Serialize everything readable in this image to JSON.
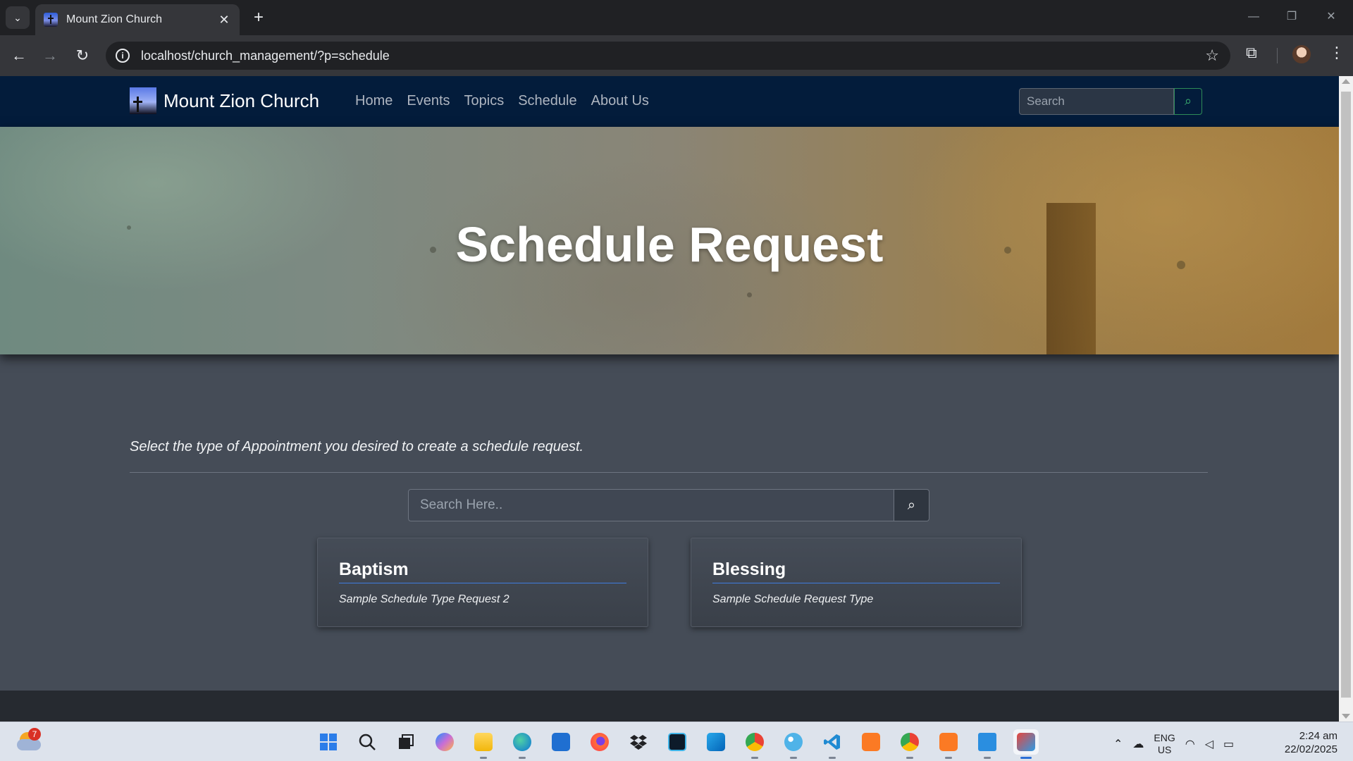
{
  "browser": {
    "tab_title": "Mount Zion Church",
    "url": "localhost/church_management/?p=schedule"
  },
  "site": {
    "brand_name": "Mount Zion Church",
    "nav_links": [
      "Home",
      "Events",
      "Topics",
      "Schedule",
      "About Us"
    ],
    "search_placeholder": "Search"
  },
  "hero": {
    "title": "Schedule Request"
  },
  "content": {
    "intro": "Select the type of Appointment you desired to create a schedule request.",
    "search_placeholder": "Search Here..",
    "cards": [
      {
        "title": "Baptism",
        "description": "Sample Schedule Type Request 2"
      },
      {
        "title": "Blessing",
        "description": "Sample Schedule Request Type"
      }
    ]
  },
  "taskbar": {
    "weather_badge": "7",
    "lang_line1": "ENG",
    "lang_line2": "US",
    "time": "2:24 am",
    "date": "22/02/2025"
  },
  "colors": {
    "site_nav_bg": "#031c3b",
    "page_bg": "#454c57",
    "card_accent": "#3f7de0",
    "search_accent": "#3cb371"
  }
}
